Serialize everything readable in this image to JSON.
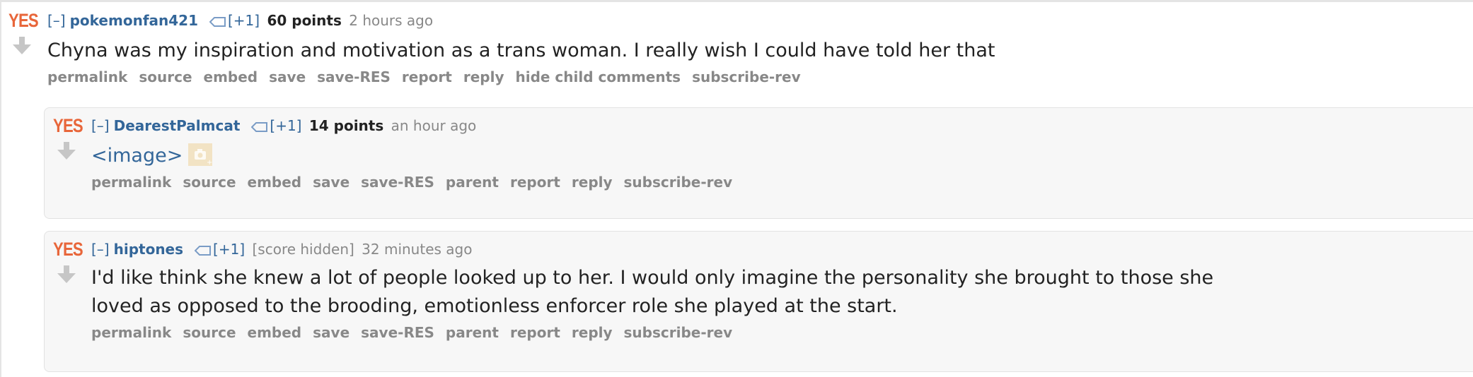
{
  "top_comment": {
    "vote_label": "YES",
    "expand": "[–]",
    "author": "pokemonfan421",
    "plus_one": "[+1]",
    "score": "60 points",
    "time": "2 hours ago",
    "body": "Chyna was my inspiration and motivation as a trans woman. I really wish I could have told her that",
    "buttons": [
      "permalink",
      "source",
      "embed",
      "save",
      "save-RES",
      "report",
      "reply",
      "hide child comments",
      "subscribe-rev"
    ]
  },
  "reply_1": {
    "vote_label": "YES",
    "expand": "[–]",
    "author": "DearestPalmcat",
    "plus_one": "[+1]",
    "score": "14 points",
    "time": "an hour ago",
    "image_link": "<image>",
    "buttons": [
      "permalink",
      "source",
      "embed",
      "save",
      "save-RES",
      "parent",
      "report",
      "reply",
      "subscribe-rev"
    ]
  },
  "reply_2": {
    "vote_label": "YES",
    "expand": "[–]",
    "author": "hiptones",
    "plus_one": "[+1]",
    "score_hidden": "[score hidden]",
    "time": "32 minutes ago",
    "body_line1": "I'd like think she knew a lot of people looked up to her. I would only imagine the personality she brought to those she",
    "body_line2": "loved as opposed to the brooding, emotionless enforcer role she played at the start.",
    "buttons": [
      "permalink",
      "source",
      "embed",
      "save",
      "save-RES",
      "parent",
      "report",
      "reply",
      "subscribe-rev"
    ]
  },
  "colors": {
    "link": "#336699",
    "meta": "#888888",
    "vote_yes": "#e8663a",
    "child_bg": "#f7f7f7"
  },
  "icons": [
    "yes-upvote-icon",
    "downvote-arrow-icon",
    "tag-icon",
    "image-thumbnail-icon"
  ]
}
